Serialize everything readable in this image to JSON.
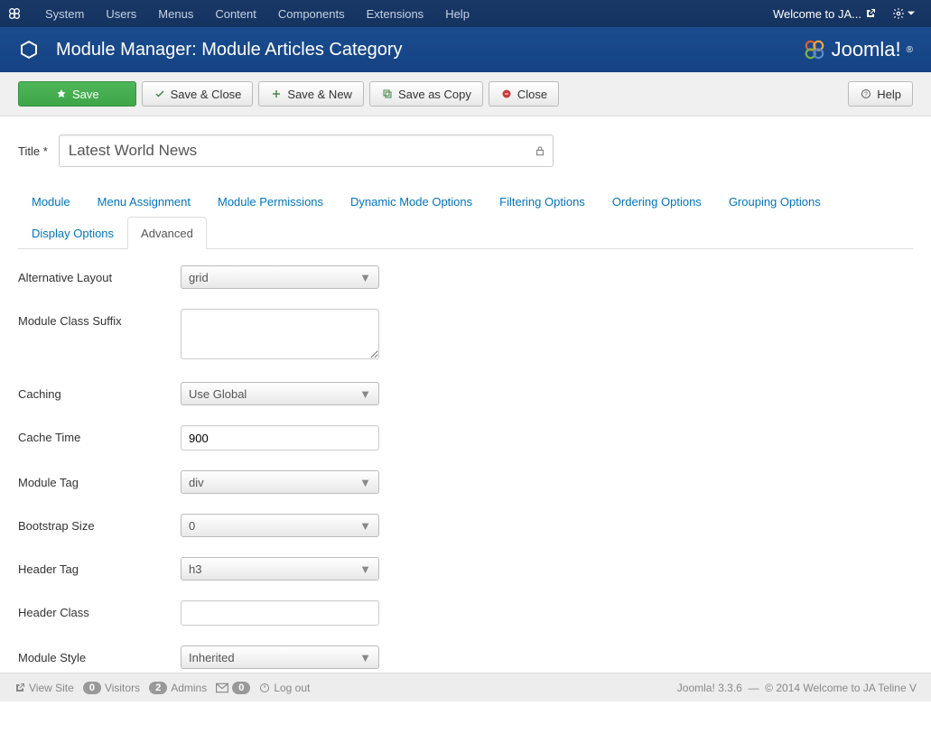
{
  "topnav": {
    "items": [
      "System",
      "Users",
      "Menus",
      "Content",
      "Components",
      "Extensions",
      "Help"
    ],
    "welcome": "Welcome to JA..."
  },
  "pagehead": {
    "title": "Module Manager: Module Articles Category",
    "brand": "Joomla!"
  },
  "toolbar": {
    "save": "Save",
    "save_close": "Save & Close",
    "save_new": "Save & New",
    "save_copy": "Save as Copy",
    "close": "Close",
    "help": "Help"
  },
  "form": {
    "title_label": "Title *",
    "title_value": "Latest World News"
  },
  "tabs": [
    "Module",
    "Menu Assignment",
    "Module Permissions",
    "Dynamic Mode Options",
    "Filtering Options",
    "Ordering Options",
    "Grouping Options",
    "Display Options",
    "Advanced"
  ],
  "active_tab": "Advanced",
  "fields": {
    "alt_layout": {
      "label": "Alternative Layout",
      "value": "grid"
    },
    "mod_class_suffix": {
      "label": "Module Class Suffix",
      "value": ""
    },
    "caching": {
      "label": "Caching",
      "value": "Use Global"
    },
    "cache_time": {
      "label": "Cache Time",
      "value": "900"
    },
    "module_tag": {
      "label": "Module Tag",
      "value": "div"
    },
    "bootstrap_size": {
      "label": "Bootstrap Size",
      "value": "0"
    },
    "header_tag": {
      "label": "Header Tag",
      "value": "h3"
    },
    "header_class": {
      "label": "Header Class",
      "value": ""
    },
    "module_style": {
      "label": "Module Style",
      "value": "Inherited"
    }
  },
  "footer": {
    "view_site": "View Site",
    "visitors_count": "0",
    "visitors": "Visitors",
    "admins_count": "2",
    "admins": "Admins",
    "messages_count": "0",
    "logout": "Log out",
    "version": "Joomla! 3.3.6",
    "sep": "—",
    "copyright": "© 2014 Welcome to JA Teline V"
  }
}
